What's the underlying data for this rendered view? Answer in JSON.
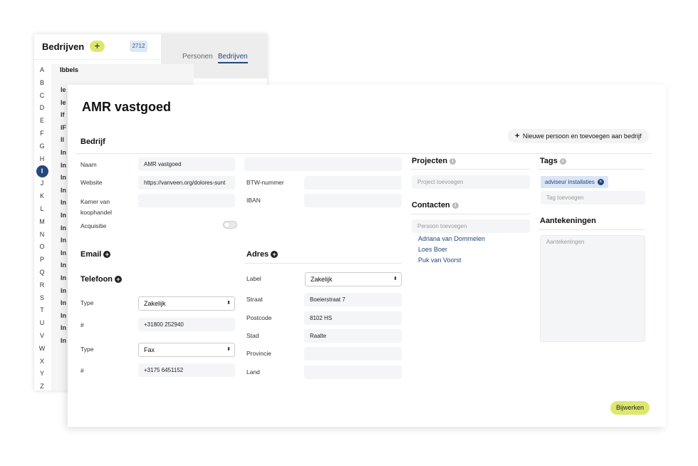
{
  "list": {
    "title": "Bedrijven",
    "add_label": "+",
    "count": "2712",
    "tabs": [
      "Personen",
      "Bedrijven"
    ],
    "letters": [
      "A",
      "B",
      "C",
      "D",
      "E",
      "F",
      "G",
      "H",
      "I",
      "J",
      "K",
      "L",
      "M",
      "N",
      "O",
      "P",
      "Q",
      "R",
      "S",
      "T",
      "U",
      "V",
      "W",
      "X",
      "Y",
      "Z"
    ],
    "active_letter": "I",
    "first_item": "Ibbels",
    "stubs": [
      "Ie",
      "Ie",
      "If",
      "IF",
      "Il",
      "In",
      "In",
      "In",
      "In",
      "In",
      "In",
      "In",
      "In",
      "In",
      "In",
      "In",
      "In",
      "In",
      "In",
      "In",
      "In"
    ]
  },
  "modal": {
    "title": "AMR vastgoed",
    "new_person_button": "Nieuwe persoon en toevoegen aan bedrijf",
    "new_person_plus": "+",
    "company": {
      "section_title": "Bedrijf",
      "name_label": "Naam",
      "name_value": "AMR vastgoed",
      "website_label": "Website",
      "website_value": "https://vanveen.org/dolores-sunt",
      "kvk_label": "Kamer van koophandel",
      "kvk_value": "",
      "acquisitie_label": "Acquisitie",
      "acquisitie_on": false,
      "btw_label": "BTW-nummer",
      "btw_value": "",
      "iban_label": "IBAN",
      "iban_value": ""
    },
    "email": {
      "section_title": "Email"
    },
    "phone": {
      "section_title": "Telefoon",
      "type_label": "Type",
      "number_label": "#",
      "entries": [
        {
          "type": "Zakelijk",
          "number": "+31800 252940"
        },
        {
          "type": "Fax",
          "number": "+3175 6451152"
        }
      ]
    },
    "address": {
      "section_title": "Adres",
      "label_label": "Label",
      "label_value": "Zakelijk",
      "street_label": "Straat",
      "street_value": "Boeierstraat 7",
      "postcode_label": "Postcode",
      "postcode_value": "8102 HS",
      "city_label": "Stad",
      "city_value": "Raalte",
      "province_label": "Provincie",
      "province_value": "",
      "country_label": "Land",
      "country_value": ""
    },
    "projects": {
      "section_title": "Projecten",
      "placeholder": "Project toevoegen"
    },
    "contacts": {
      "section_title": "Contacten",
      "placeholder": "Persoon toevoegen",
      "people": [
        "Adriana van Dommelen",
        "Loes Boer",
        "Puk van Voorst"
      ]
    },
    "tags": {
      "section_title": "Tags",
      "items": [
        "adviseur installaties"
      ],
      "placeholder": "Tag toevoegen"
    },
    "notes": {
      "section_title": "Aantekeningen",
      "placeholder": "Aantekeningen"
    },
    "info_glyph": "i",
    "remove_glyph": "×",
    "select_arrow": "⬍",
    "update_button": "Bijwerken"
  },
  "colors": {
    "accent_yellow": "#dce86d",
    "brand_blue": "#23477e",
    "tag_bg": "#dbe6f5"
  },
  "icons": [
    "plus-icon",
    "info-icon",
    "close-icon",
    "chevron-updown-icon"
  ]
}
